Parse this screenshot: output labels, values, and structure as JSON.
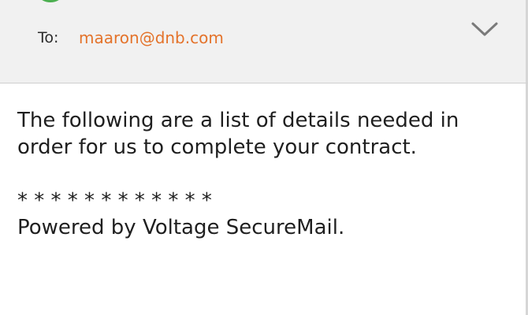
{
  "email": {
    "to_label": "To:",
    "to_address": "maaron@dnb.com",
    "expand_icon": "chevron-down-icon",
    "body_line_1": "The following are a list of details needed in",
    "body_line_2": "order for us to complete your contract.",
    "separator": "* * * * * * * * * * * *",
    "footer": "Powered by Voltage SecureMail."
  },
  "colors": {
    "header_bg": "#f1f1f1",
    "address": "#e4732b",
    "badge": "#4caf50"
  }
}
